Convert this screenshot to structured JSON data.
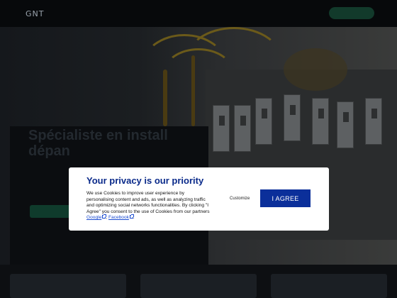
{
  "header": {
    "logo": "GNT",
    "nav_items": [
      "",
      ""
    ],
    "cta_label": ""
  },
  "hero": {
    "eyebrow": "",
    "title": "Spécialiste en install dépan",
    "text": "",
    "primary_button": "",
    "secondary_button": ""
  },
  "cookie_modal": {
    "title": "Your privacy is our priority",
    "body": "We use Cookies to improve user experience by personalising content and ads, as well as analyzing traffic and optimizing social networks functionalities. By clicking \"I Agree\" you consent to the use of Cookies from our partners",
    "link_google": "Google",
    "separator": ",",
    "link_facebook": "Facebook",
    "end": ".",
    "customize_label": "Customize",
    "agree_label": "I AGREE",
    "agree_color": "#0b2f9a",
    "title_color": "#0a2a8a"
  }
}
